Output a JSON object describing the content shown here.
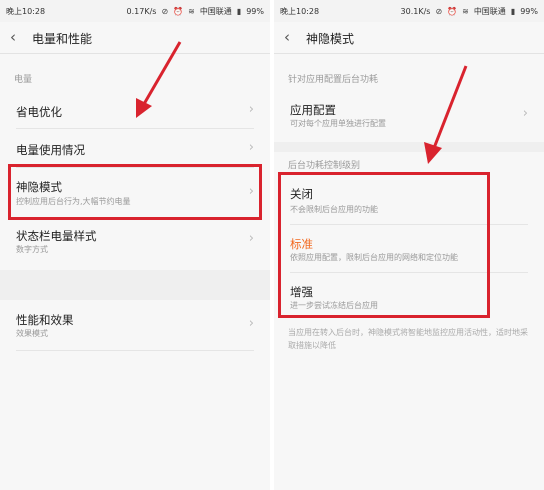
{
  "left": {
    "status": {
      "time": "晚上10:28",
      "speed": "0.17K/s",
      "carrier": "中国联通",
      "battery": "99%"
    },
    "title": "电量和性能",
    "section_label": "电量",
    "items": [
      {
        "label": "省电优化"
      },
      {
        "label": "电量使用情况"
      },
      {
        "label": "神隐模式",
        "sub": "控制应用后台行为,大幅节约电量"
      },
      {
        "label": "状态栏电量样式",
        "sub": "数字方式"
      },
      {
        "label": "性能和效果",
        "sub": "效果模式"
      }
    ]
  },
  "right": {
    "status": {
      "time": "晚上10:28",
      "speed": "30.1K/s",
      "carrier": "中国联通",
      "battery": "99%"
    },
    "title": "神隐模式",
    "section1_label": "针对应用配置后台功耗",
    "app_config": {
      "label": "应用配置",
      "sub": "可对每个应用单独进行配置"
    },
    "section2_label": "后台功耗控制级别",
    "options": [
      {
        "label": "关闭",
        "sub": "不会限制后台应用的功能"
      },
      {
        "label": "标准",
        "sub": "依照应用配置，限制后台应用的网络和定位功能"
      },
      {
        "label": "增强",
        "sub": "进一步尝试冻结后台应用"
      }
    ],
    "note": "当应用在转入后台时，神隐模式将智能地监控应用活动性，适时地采取措施以降低"
  },
  "colors": {
    "highlight": "#d9232e",
    "selected": "#f26a21"
  },
  "icons": [
    "back-chevron-icon",
    "chevron-right-icon",
    "wifi-icon",
    "battery-icon",
    "alarm-icon",
    "silent-icon"
  ]
}
